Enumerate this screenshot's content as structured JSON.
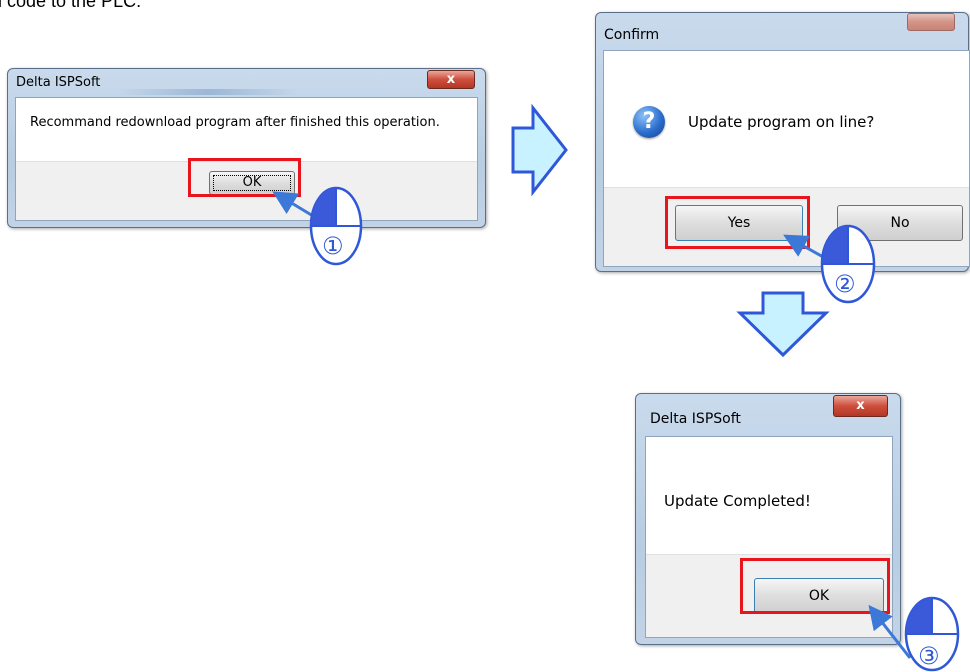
{
  "intro_text": "l code to the PLC.",
  "dialog1": {
    "title": "Delta ISPSoft",
    "close": "x",
    "message": "Recommand redownload program after finished this operation.",
    "ok_label": "OK"
  },
  "dialog2": {
    "title": "Confirm",
    "close": "",
    "message": "Update program on line?",
    "question_glyph": "?",
    "yes_label": "Yes",
    "no_label": "No"
  },
  "dialog3": {
    "title": "Delta ISPSoft",
    "close": "x",
    "message": "Update Completed!",
    "ok_label": "OK"
  },
  "steps": [
    {
      "label": "①"
    },
    {
      "label": "②"
    },
    {
      "label": "③"
    }
  ],
  "colors": {
    "highlight": "#e8161c",
    "flow_arrow_fill": "#c8f2ff",
    "flow_arrow_stroke": "#2f58d8",
    "pointer_arrow": "#3c78d8"
  },
  "icons": {
    "mouse": "mouse-left-click-icon",
    "flow_right": "flow-arrow-right-icon",
    "flow_down": "flow-arrow-down-icon",
    "question": "question-icon"
  }
}
